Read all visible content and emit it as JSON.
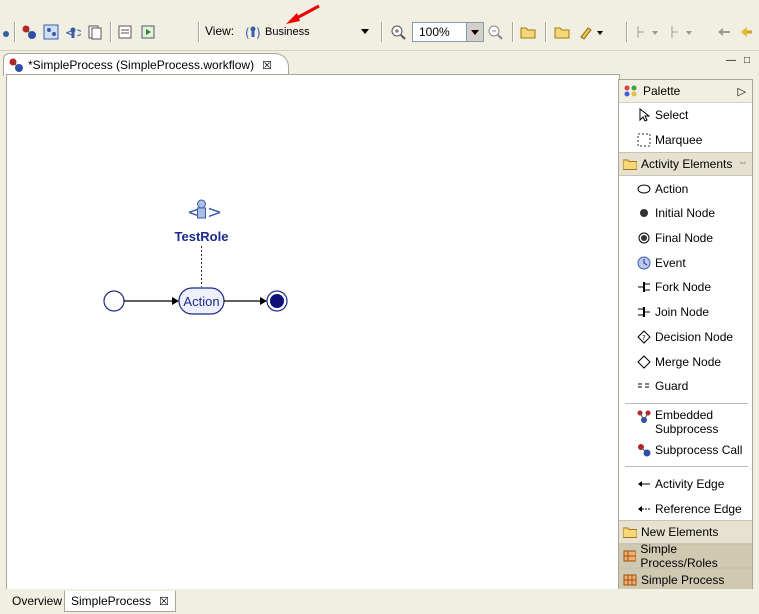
{
  "toolbar": {
    "view_label": "View:",
    "view_value": "Business",
    "zoom_value": "100%"
  },
  "editor": {
    "tab_label": "*SimpleProcess (SimpleProcess.workflow)",
    "tab_close": "☒"
  },
  "diagram": {
    "role_label": "TestRole",
    "action_label": "Action"
  },
  "palette": {
    "title": "Palette",
    "tools": [
      {
        "label": "Select",
        "icon": "select-arrow-icon"
      },
      {
        "label": "Marquee",
        "icon": "marquee-icon"
      }
    ],
    "drawer_activity": "Activity Elements",
    "activity_items": [
      {
        "label": "Action",
        "icon": "action-oval-icon"
      },
      {
        "label": "Initial Node",
        "icon": "initial-node-icon"
      },
      {
        "label": "Final Node",
        "icon": "final-node-icon"
      },
      {
        "label": "Event",
        "icon": "event-icon"
      },
      {
        "label": "Fork Node",
        "icon": "fork-node-icon"
      },
      {
        "label": "Join Node",
        "icon": "join-node-icon"
      },
      {
        "label": "Decision Node",
        "icon": "decision-node-icon"
      },
      {
        "label": "Merge Node",
        "icon": "merge-node-icon"
      },
      {
        "label": "Guard",
        "icon": "guard-icon"
      }
    ],
    "subprocess_items": [
      {
        "label": "Embedded Subprocess",
        "line1": "Embedded",
        "line2": "Subprocess",
        "icon": "embedded-subprocess-icon"
      },
      {
        "label": "Subprocess Call",
        "icon": "subprocess-call-icon"
      }
    ],
    "edge_items": [
      {
        "label": "Activity Edge",
        "icon": "activity-edge-icon"
      },
      {
        "label": "Reference Edge",
        "icon": "reference-edge-icon"
      }
    ],
    "drawers": [
      {
        "label": "New Elements"
      },
      {
        "label": "Simple Process/Roles"
      },
      {
        "label": "Simple Process"
      }
    ]
  },
  "bottom_tabs": [
    {
      "label": "Overview"
    },
    {
      "label": "SimpleProcess",
      "close": "☒"
    }
  ]
}
